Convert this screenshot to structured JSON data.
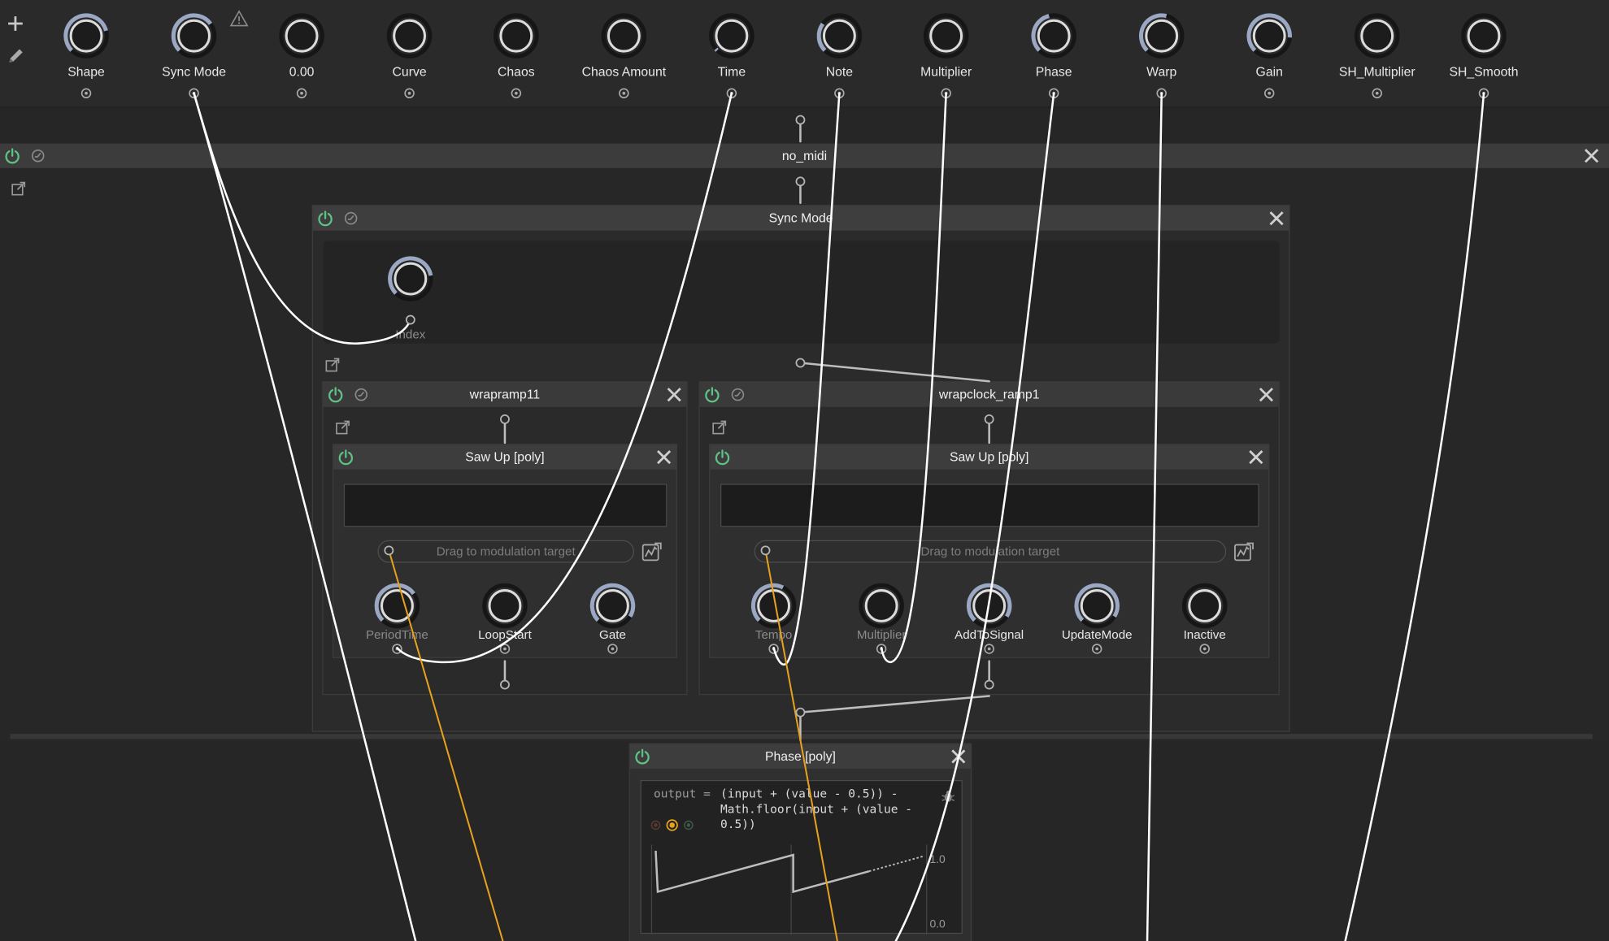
{
  "toolbar": {
    "add_icon": "plus-icon",
    "edit_icon": "pencil-icon"
  },
  "macros": [
    {
      "label": "Shape",
      "value": 0.78
    },
    {
      "label": "Sync Mode",
      "value": 0.7
    },
    {
      "label": "0.00",
      "value": 0.0
    },
    {
      "label": "Curve",
      "value": 0.0
    },
    {
      "label": "Chaos",
      "value": 0.0
    },
    {
      "label": "Chaos Amount",
      "value": 0.0
    },
    {
      "label": "Time",
      "value": 0.02
    },
    {
      "label": "Note",
      "value": 0.3
    },
    {
      "label": "Multiplier",
      "value": 0.0
    },
    {
      "label": "Phase",
      "value": 0.45
    },
    {
      "label": "Warp",
      "value": 0.55
    },
    {
      "label": "Gain",
      "value": 0.85
    },
    {
      "label": "SH_Multiplier",
      "value": 0.0
    },
    {
      "label": "SH_Smooth",
      "value": 0.0
    }
  ],
  "warning_icon": "warning-triangle-icon",
  "panels": {
    "no_midi": {
      "title": "no_midi"
    },
    "sync_mode": {
      "title": "Sync Mode",
      "index_label": "Index",
      "index_value": 0.8
    },
    "wrapramp11": {
      "title": "wrapramp11"
    },
    "wrapclock_ramp1": {
      "title": "wrapclock_ramp1"
    },
    "saw_up_left": {
      "title": "Saw Up [poly]",
      "mod_target": "Drag to modulation target",
      "knobs": [
        {
          "label": "PeriodTime",
          "value": 0.7,
          "dim": true
        },
        {
          "label": "LoopStart",
          "value": 0.0,
          "dim": false
        },
        {
          "label": "Gate",
          "value": 0.95,
          "dim": false
        }
      ]
    },
    "saw_up_right": {
      "title": "Saw Up [poly]",
      "mod_target": "Drag to modulation target",
      "knobs": [
        {
          "label": "Tempo",
          "value": 0.6,
          "dim": true
        },
        {
          "label": "Multiplier",
          "value": 0.0,
          "dim": true
        },
        {
          "label": "AddToSignal",
          "value": 0.95,
          "dim": false
        },
        {
          "label": "UpdateMode",
          "value": 0.95,
          "dim": false
        },
        {
          "label": "Inactive",
          "value": 0.0,
          "dim": false
        }
      ]
    },
    "phase": {
      "title": "Phase [poly]",
      "code_prefix": "output =",
      "code_lines": [
        "(input + (value - 0.5)) -",
        "Math.floor(input + (value -",
        "0.5))"
      ],
      "y_max_label": "1.0",
      "y_min_label": "0.0"
    }
  },
  "colors": {
    "power": "#5fc285",
    "knob_ring": "#9aa8c4",
    "wire_white": "#ffffff",
    "wire_orange": "#e6a21e",
    "panel_bg": "#2b2b2b",
    "header_bg": "#3a3a3a"
  }
}
